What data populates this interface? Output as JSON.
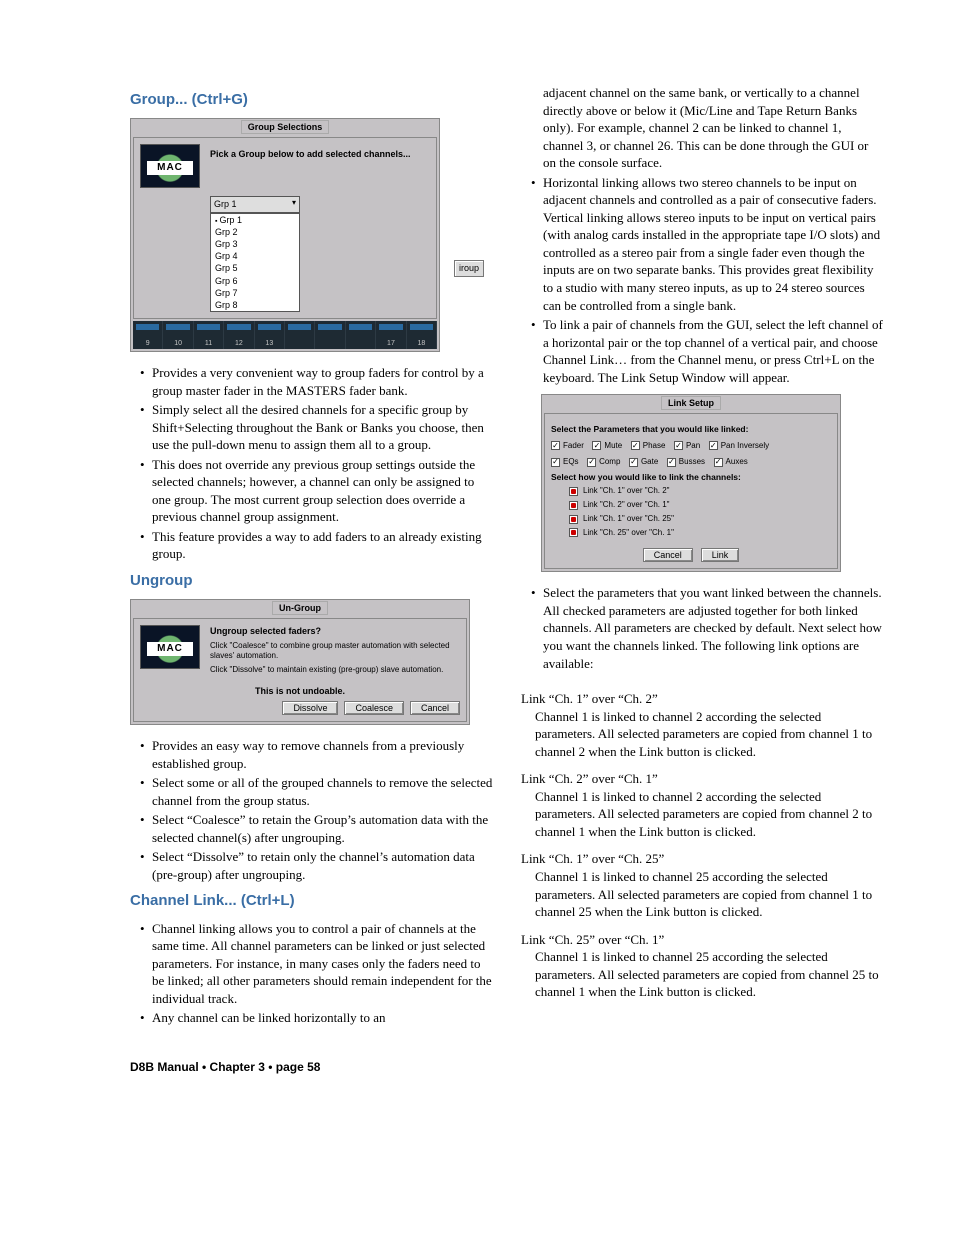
{
  "left": {
    "h_group": "Group... (Ctrl+G)",
    "group_win": {
      "title": "Group Selections",
      "prompt": "Pick a Group below to add selected channels...",
      "selected": "Grp 1",
      "options": [
        "Grp 1",
        "Grp 2",
        "Grp 3",
        "Grp 4",
        "Grp 5",
        "Grp 6",
        "Grp 7",
        "Grp 8"
      ],
      "side_btn": "iroup",
      "ch_nums": [
        "9",
        "10",
        "11",
        "12",
        "13",
        "",
        "",
        "",
        "17",
        "18"
      ]
    },
    "group_bullets": [
      "Provides a very convenient way to group faders for control by a group master fader in the MASTERS fader bank.",
      "Simply select all the desired channels for a specific group by Shift+Selecting throughout the Bank or Banks you choose, then use the pull-down menu to assign them all to a group.",
      "This does not override any previous group settings outside the selected channels; however, a channel can only be assigned to one group. The most current group selection does override a previous channel group assignment.",
      "This feature provides a way to add faders to an already existing group."
    ],
    "h_ungroup": "Ungroup",
    "ungroup_win": {
      "title": "Un-Group",
      "q": "Ungroup selected faders?",
      "line1": "Click \"Coalesce\" to combine group master automation with selected slaves' automation.",
      "line2": "Click \"Dissolve\" to maintain existing (pre-group) slave automation.",
      "warn": "This is not undoable.",
      "b1": "Dissolve",
      "b2": "Coalesce",
      "b3": "Cancel"
    },
    "ungroup_bullets": [
      "Provides an easy way to remove channels from a previously established group.",
      "Select some or all of the grouped channels to remove the selected channel from the group status.",
      "Select “Coalesce” to retain the Group’s automation data with the selected channel(s) after ungrouping.",
      "Select “Dissolve” to retain only the channel’s automation data (pre-group) after ungrouping."
    ],
    "h_link": "Channel Link... (Ctrl+L)",
    "link_bullets": [
      "Channel linking allows you to control a pair of channels at the same time. All channel parameters can be linked or just selected parameters. For instance, in many cases only the faders need to be linked; all other parameters should remain independent for the individual track.",
      "Any channel can be linked horizontally to an"
    ]
  },
  "right": {
    "cont_para": "adjacent channel on the same bank, or vertically to a channel directly above or below it (Mic/Line and Tape Return Banks only). For example, channel 2 can be linked to channel 1, channel 3, or channel 26. This can be done through the GUI or on the console surface.",
    "bullets1": [
      "Horizontal linking allows two stereo channels to be input on adjacent channels and controlled as a pair of consecutive faders. Vertical linking allows stereo inputs to be input on vertical pairs (with analog cards installed in the appropriate tape I/O slots) and controlled as a stereo pair from a single fader even though the inputs are on two separate banks. This provides great flexibility to a studio with many stereo inputs, as up to 24 stereo sources can be controlled from a single bank.",
      "To link a pair of channels from the GUI, select the left channel of a horizontal pair or the top channel of a vertical pair, and choose Channel Link… from the Channel menu, or press Ctrl+L on the keyboard. The Link Setup Window will appear."
    ],
    "link_win": {
      "title": "Link Setup",
      "params_title": "Select the Parameters that you would like linked:",
      "row1": [
        "Fader",
        "Mute",
        "Phase",
        "Pan",
        "Pan Inversely"
      ],
      "row2": [
        "EQs",
        "Comp",
        "Gate",
        "Busses",
        "Auxes"
      ],
      "how_title": "Select how you would like to link the channels:",
      "radios": [
        "Link  \"Ch. 1\"  over  \"Ch. 2\"",
        "Link  \"Ch. 2\"  over  \"Ch. 1\"",
        "Link  \"Ch. 1\"  over  \"Ch. 25\"",
        "Link  \"Ch. 25\"  over  \"Ch. 1\""
      ],
      "cancel": "Cancel",
      "link": "Link"
    },
    "bullets2": [
      "Select the parameters that you want linked between the channels. All checked parameters are adjusted together for both linked channels. All parameters are checked by default. Next select how you want the channels linked. The following link options are available:"
    ],
    "defs": [
      {
        "h": "Link “Ch. 1” over “Ch. 2”",
        "b": "Channel 1 is linked to channel 2 according the selected parameters. All selected parameters are copied from channel 1 to channel 2 when the Link button is clicked."
      },
      {
        "h": "Link “Ch. 2” over “Ch. 1”",
        "b": "Channel 1 is linked to channel 2 according the selected parameters. All selected parameters are copied from channel 2 to channel 1 when the Link button is clicked."
      },
      {
        "h": "Link “Ch. 1” over “Ch. 25”",
        "b": "Channel 1 is linked to channel 25 according the selected parameters. All selected parameters are copied from channel 1 to channel 25 when the Link button is clicked."
      },
      {
        "h": "Link “Ch. 25” over “Ch. 1”",
        "b": "Channel 1 is linked to channel 25 according the selected parameters. All selected parameters are copied from channel 25 to channel 1 when the Link button is clicked."
      }
    ]
  },
  "footer": "D8B Manual • Chapter 3 • page  58"
}
